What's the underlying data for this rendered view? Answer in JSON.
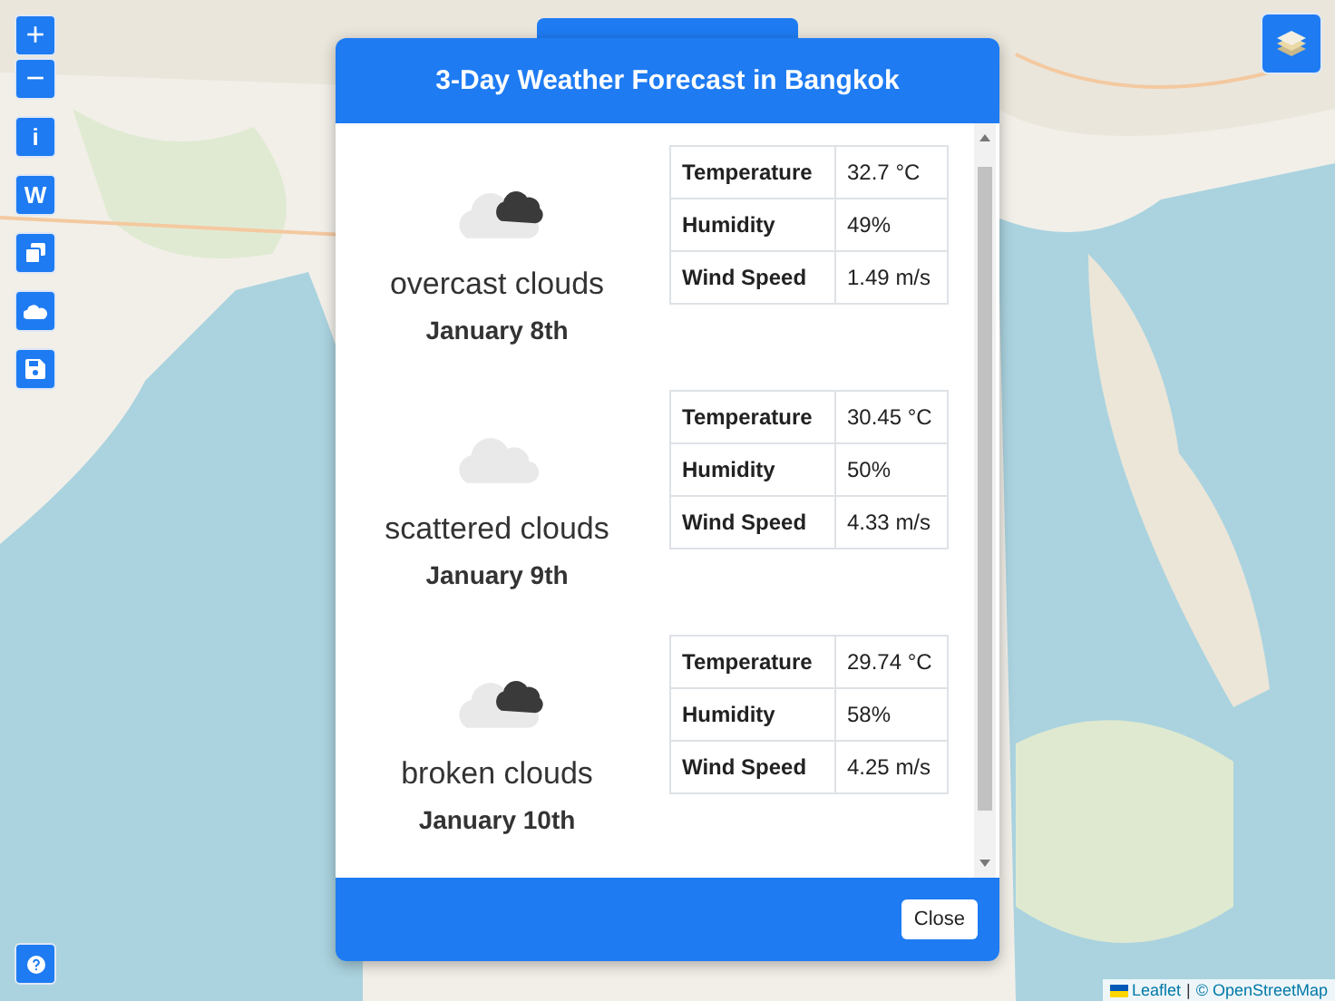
{
  "map": {
    "kind": "picture"
  },
  "zoom_controls": [
    "+",
    "−"
  ],
  "side_buttons": [
    {
      "kind": "text",
      "label": "i"
    },
    {
      "kind": "text",
      "label": "W"
    },
    {
      "kind": "copy"
    },
    {
      "kind": "cloud"
    },
    {
      "kind": "save"
    }
  ],
  "help_button": {
    "kind": "help"
  },
  "attribution": {
    "leaflet_link": "Leaflet",
    "separator": "|",
    "osm_link": "© OpenStreetMap"
  },
  "modal": {
    "title": "3-Day Weather Forecast in Bangkok",
    "days": [
      {
        "kind": "two_clouds",
        "condition": "overcast clouds",
        "date": "January 8th",
        "rows": [
          {
            "label": "Temperature",
            "value": "32.7 °C"
          },
          {
            "label": "Humidity",
            "value": "49%"
          },
          {
            "label": "Wind Speed",
            "value": "1.49 m/s"
          }
        ]
      },
      {
        "kind": "one_cloud",
        "condition": "scattered clouds",
        "date": "January 9th",
        "rows": [
          {
            "label": "Temperature",
            "value": "30.45 °C"
          },
          {
            "label": "Humidity",
            "value": "50%"
          },
          {
            "label": "Wind Speed",
            "value": "4.33 m/s"
          }
        ]
      },
      {
        "kind": "two_clouds",
        "condition": "broken clouds",
        "date": "January 10th",
        "rows": [
          {
            "label": "Temperature",
            "value": "29.74 °C"
          },
          {
            "label": "Humidity",
            "value": "58%"
          },
          {
            "label": "Wind Speed",
            "value": "4.25 m/s"
          }
        ]
      }
    ],
    "close_button": "Close"
  }
}
